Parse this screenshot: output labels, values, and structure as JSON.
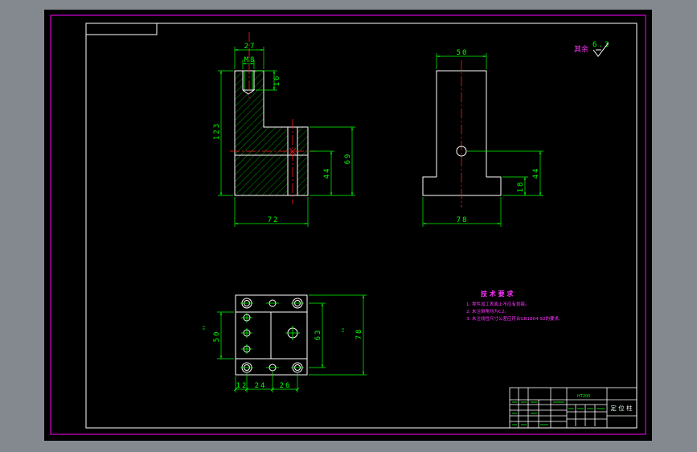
{
  "colors": {
    "viewer_background": "#848990",
    "canvas": "#000000",
    "sheet_border": "#ff00ff",
    "frame": "#ffffff",
    "dimension": "#00ff00",
    "centerline": "#ff2020",
    "note": "#ff33ff"
  },
  "front_section_view": {
    "dims": {
      "top_width": "27",
      "thread": "M8",
      "thread_depth": "16",
      "height": "123",
      "step_height": "69",
      "hole_height": "44",
      "width": "72"
    }
  },
  "side_view": {
    "dims": {
      "upright_width": "50",
      "hole_height": "44",
      "base_height": "18",
      "width": "78"
    }
  },
  "top_view": {
    "dims": {
      "hole_spacing": "50",
      "row_spacing": "63",
      "depth": "78",
      "offset_1": "12",
      "offset_2": "24",
      "offset_3": "26"
    }
  },
  "surface_finish": {
    "label": "其余",
    "value": "6.3",
    "icon": "roughness-symbol-icon"
  },
  "technical_requirements": {
    "heading": "技 术 要 求",
    "items": [
      "1. 零件加工表面上不应有划痕。",
      "2. 未注倒角均为C2。",
      "3. 未注线性尺寸公差应符合GB1804-92的要求。"
    ]
  },
  "title_block": {
    "material": "HT200",
    "part_name": "定 位 柱"
  }
}
